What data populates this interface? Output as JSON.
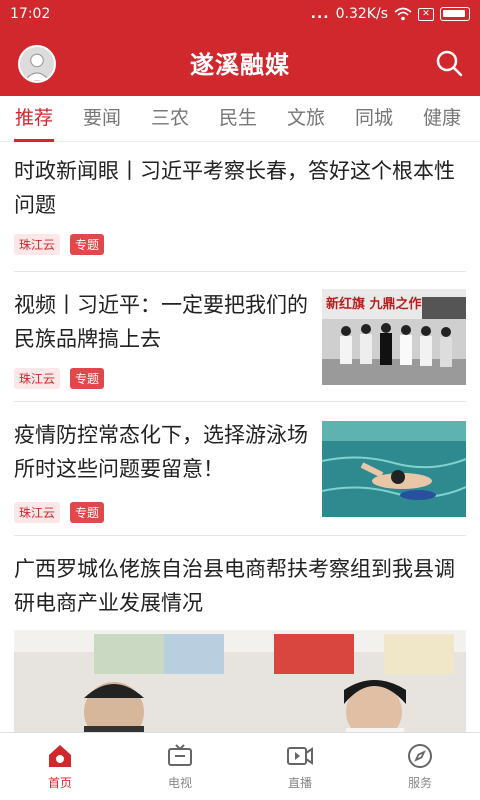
{
  "status": {
    "time": "17:02",
    "dots": "...",
    "speed": "0.32K/s",
    "sim": "✕"
  },
  "header": {
    "title": "遂溪融媒"
  },
  "tabs": [
    "推荐",
    "要闻",
    "三农",
    "民生",
    "文旅",
    "同城",
    "健康"
  ],
  "news": [
    {
      "title": "时政新闻眼丨习近平考察长春，答好这个根本性问题",
      "source": "珠江云",
      "tag": "专题"
    },
    {
      "title": "视频丨习近平：一定要把我们的民族品牌搞上去",
      "source": "珠江云",
      "tag": "专题",
      "image_caption": "新红旗 九鼎之作"
    },
    {
      "title": "疫情防控常态化下，选择游泳场所时这些问题要留意！",
      "source": "珠江云",
      "tag": "专题"
    },
    {
      "title": "广西罗城仫佬族自治县电商帮扶考察组到我县调研电商产业发展情况"
    }
  ],
  "bottom_nav": [
    "首页",
    "电视",
    "直播",
    "服务"
  ]
}
